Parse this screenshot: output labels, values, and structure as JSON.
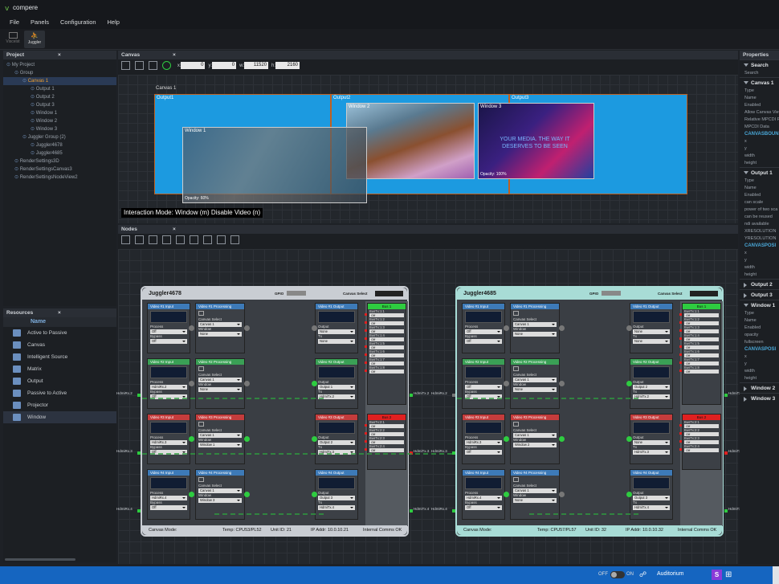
{
  "app": {
    "name": "compere"
  },
  "menu": [
    "File",
    "Panels",
    "Configuration",
    "Help"
  ],
  "toolbar": {
    "buttons": [
      {
        "label": "Viscelst",
        "icon": "monitor-icon"
      },
      {
        "label": "Juggler",
        "icon": "juggler-icon"
      }
    ]
  },
  "project": {
    "title": "Project",
    "items": [
      {
        "label": "My Project",
        "indent": 0
      },
      {
        "label": "Group",
        "indent": 1
      },
      {
        "label": "Canvas 1",
        "indent": 2,
        "selected": true
      },
      {
        "label": "Output 1",
        "indent": 3
      },
      {
        "label": "Output 2",
        "indent": 3
      },
      {
        "label": "Output 3",
        "indent": 3
      },
      {
        "label": "Window 1",
        "indent": 3
      },
      {
        "label": "Window 2",
        "indent": 3
      },
      {
        "label": "Window 3",
        "indent": 3
      },
      {
        "label": "Juggler Group (2)",
        "indent": 2
      },
      {
        "label": "Juggler4678",
        "indent": 3
      },
      {
        "label": "Juggler4685",
        "indent": 3
      },
      {
        "label": "RenderSettings3D",
        "indent": 1
      },
      {
        "label": "RenderSettingsCanvas3",
        "indent": 1
      },
      {
        "label": "RenderSettingsNodeView2",
        "indent": 1
      }
    ]
  },
  "resources": {
    "title": "Resources",
    "column": "Name",
    "items": [
      "Active to Passive",
      "Canvas",
      "Intelligent Source",
      "Matrix",
      "Output",
      "Passive to Active",
      "Projector",
      "Window"
    ]
  },
  "canvas_panel": {
    "title": "Canvas",
    "fields": [
      {
        "label": "x:",
        "value": "0"
      },
      {
        "label": "y:",
        "value": "0"
      },
      {
        "label": "w:",
        "value": "11520"
      },
      {
        "label": "h:",
        "value": "2160"
      }
    ],
    "canvas_label": "Canvas 1",
    "outputs": [
      "Output1",
      "Output2",
      "Output3"
    ],
    "windows": [
      {
        "label": "Window 1",
        "opacity": "Opacity: 60%"
      },
      {
        "label": "Window 2",
        "opacity": ""
      },
      {
        "label": "Window 3",
        "opacity": "Opacity: 100%"
      }
    ],
    "window3_text": "YOUR MEDIA. THE WAY IT DESERVES TO BE SEEN",
    "status": "Interaction Mode: Window (m) Disable Video (n)"
  },
  "nodes_panel": {
    "title": "Nodes"
  },
  "nodes": [
    {
      "name": "Juggler4678",
      "gpio": "GPIO",
      "canvas_select": "Canvas Select",
      "footer": {
        "mode": "Canvas Mode:",
        "temp": "Temp: CPU53/PL52",
        "unit": "Unit ID: 21",
        "ip": "IP Addr: 10.0.10.21",
        "comms": "Internal Comms OK"
      },
      "inputs": [
        {
          "title": "Video #1 Input",
          "process": "Off",
          "bypass": "Off"
        },
        {
          "title": "Video #2 Input",
          "process": "HdmiRx.2",
          "bypass": "Off"
        },
        {
          "title": "Video #3 Input",
          "process": "HdmiRx.3",
          "bypass": "Off"
        },
        {
          "title": "Video #4 Input",
          "process": "HdmiRx.4",
          "bypass": "Off"
        }
      ],
      "processing": [
        {
          "title": "Video #1 Processing",
          "canvas": "Canvas 1",
          "window": "None"
        },
        {
          "title": "Video #2 Processing",
          "canvas": "Canvas 1",
          "window": "None"
        },
        {
          "title": "Video #3 Processing",
          "canvas": "Canvas 1",
          "window": "Window 1"
        },
        {
          "title": "Video #4 Processing",
          "canvas": "Canvas 1",
          "window": "Window 3"
        }
      ],
      "outputs": [
        {
          "title": "Video #1 Output",
          "output": "None",
          "tx": "None"
        },
        {
          "title": "Video #2 Output",
          "output": "Output 1",
          "tx": "HdmiTx.2"
        },
        {
          "title": "Video #3 Output",
          "output": "Output 2",
          "tx": "HdmiTx.3"
        },
        {
          "title": "Video #4 Output",
          "output": "Output 3",
          "tx": "HdmiTx.4"
        }
      ],
      "bus1": {
        "title": "Bus 1",
        "rows": [
          "BusTx:1:1",
          "BusTx:1:2",
          "BusTx:1:3",
          "BusTx:1:4",
          "BusTx:1:5",
          "BusTx:1:6",
          "BusTx:1:7",
          "BusTx:1:8"
        ]
      },
      "bus2": {
        "title": "Bus 2",
        "rows": [
          "BusTx:2:1",
          "BusTx:2:2",
          "BusTx:2:3",
          "BusTx:2:4"
        ]
      },
      "rx": [
        "HdmiRx.2",
        "HdmiRx.3",
        "HdmiRx.4"
      ],
      "tx": [
        "HdmiTx.2",
        "HdmiTx.3",
        "HdmiTx.4"
      ]
    },
    {
      "name": "Juggler4685",
      "gpio": "GPIO",
      "canvas_select": "Canvas Select",
      "footer": {
        "mode": "Canvas Mode:",
        "temp": "Temp: CPU57/PL57",
        "unit": "Unit ID: 32",
        "ip": "IP Addr: 10.0.10.32",
        "comms": "Internal Comms OK"
      },
      "inputs": [
        {
          "title": "Video #1 Input",
          "process": "Off",
          "bypass": "Off"
        },
        {
          "title": "Video #2 Input",
          "process": "Off",
          "bypass": "Off"
        },
        {
          "title": "Video #3 Input",
          "process": "HdmiRx.3",
          "bypass": "Off"
        },
        {
          "title": "Video #4 Input",
          "process": "HdmiRx.4",
          "bypass": "Off"
        }
      ],
      "processing": [
        {
          "title": "Video #1 Processing",
          "canvas": "Canvas 1",
          "window": "None"
        },
        {
          "title": "Video #2 Processing",
          "canvas": "Canvas 1",
          "window": "None"
        },
        {
          "title": "Video #3 Processing",
          "canvas": "Canvas 1",
          "window": "Window 2"
        },
        {
          "title": "Video #4 Processing",
          "canvas": "Canvas 1",
          "window": "None"
        }
      ],
      "outputs": [
        {
          "title": "Video #1 Output",
          "output": "None",
          "tx": "None"
        },
        {
          "title": "Video #2 Output",
          "output": "Output 2",
          "tx": "HdmiTx.2"
        },
        {
          "title": "Video #3 Output",
          "output": "None",
          "tx": "HdmiTx.3"
        },
        {
          "title": "Video #4 Output",
          "output": "Output 3",
          "tx": "HdmiTx.4"
        }
      ],
      "bus1": {
        "title": "Bus 1",
        "rows": [
          "BusTx:1:1",
          "BusTx:1:2",
          "BusTx:1:3",
          "BusTx:1:4",
          "BusTx:1:5",
          "BusTx:1:6",
          "BusTx:1:7",
          "BusTx:1:8"
        ]
      },
      "bus2": {
        "title": "Bus 2",
        "rows": [
          "BusTx:2:1",
          "BusTx:2:2",
          "BusTx:2:3",
          "BusTx:2:4"
        ]
      },
      "rx": [
        "HdmiRx.2",
        "HdmiRx.3",
        "HdmiRx.4"
      ],
      "tx": [
        "HdmiTx.2",
        "HdmiTx.3",
        "HdmiTx.4"
      ]
    }
  ],
  "properties": {
    "title": "Properties",
    "search": {
      "header": "Search",
      "label": "Search"
    },
    "canvas1": {
      "header": "Canvas 1",
      "rows": [
        "Type",
        "Name",
        "Enabled",
        "Allow Canvas View",
        "Relative MPCDI P",
        "MPCDI Data"
      ],
      "sub": "CANVASBOUN",
      "rows2": [
        "x",
        "y",
        "width",
        "height"
      ]
    },
    "output1": {
      "header": "Output 1",
      "rows": [
        "Type",
        "Name",
        "Enabled",
        "can scale",
        "power of two sca",
        "can be reused",
        "ndi available",
        "XRESOLUTION",
        "YRESOLUTION"
      ],
      "sub": "CANVASPOSI",
      "rows2": [
        "x",
        "y",
        "width",
        "height"
      ]
    },
    "collapsed1": [
      "Output 2",
      "Output 3"
    ],
    "window1": {
      "header": "Window 1",
      "rows": [
        "Type",
        "Name",
        "Enabled",
        "opacity",
        "fullscreen"
      ],
      "sub": "CANVASPOSI",
      "rows2": [
        "x",
        "y",
        "width",
        "height"
      ]
    },
    "collapsed2": [
      "Window 2",
      "Window 3"
    ]
  },
  "taskbar": {
    "toggle_off": "OFF",
    "toggle_on": "ON",
    "location": "Auditorium"
  },
  "colors": {
    "accent": "#f0a030",
    "node1": "#c9cdd3",
    "node2": "#a8dcd6",
    "green": "#2ecc40",
    "red": "#e02020",
    "taskbar": "#1565c0"
  }
}
